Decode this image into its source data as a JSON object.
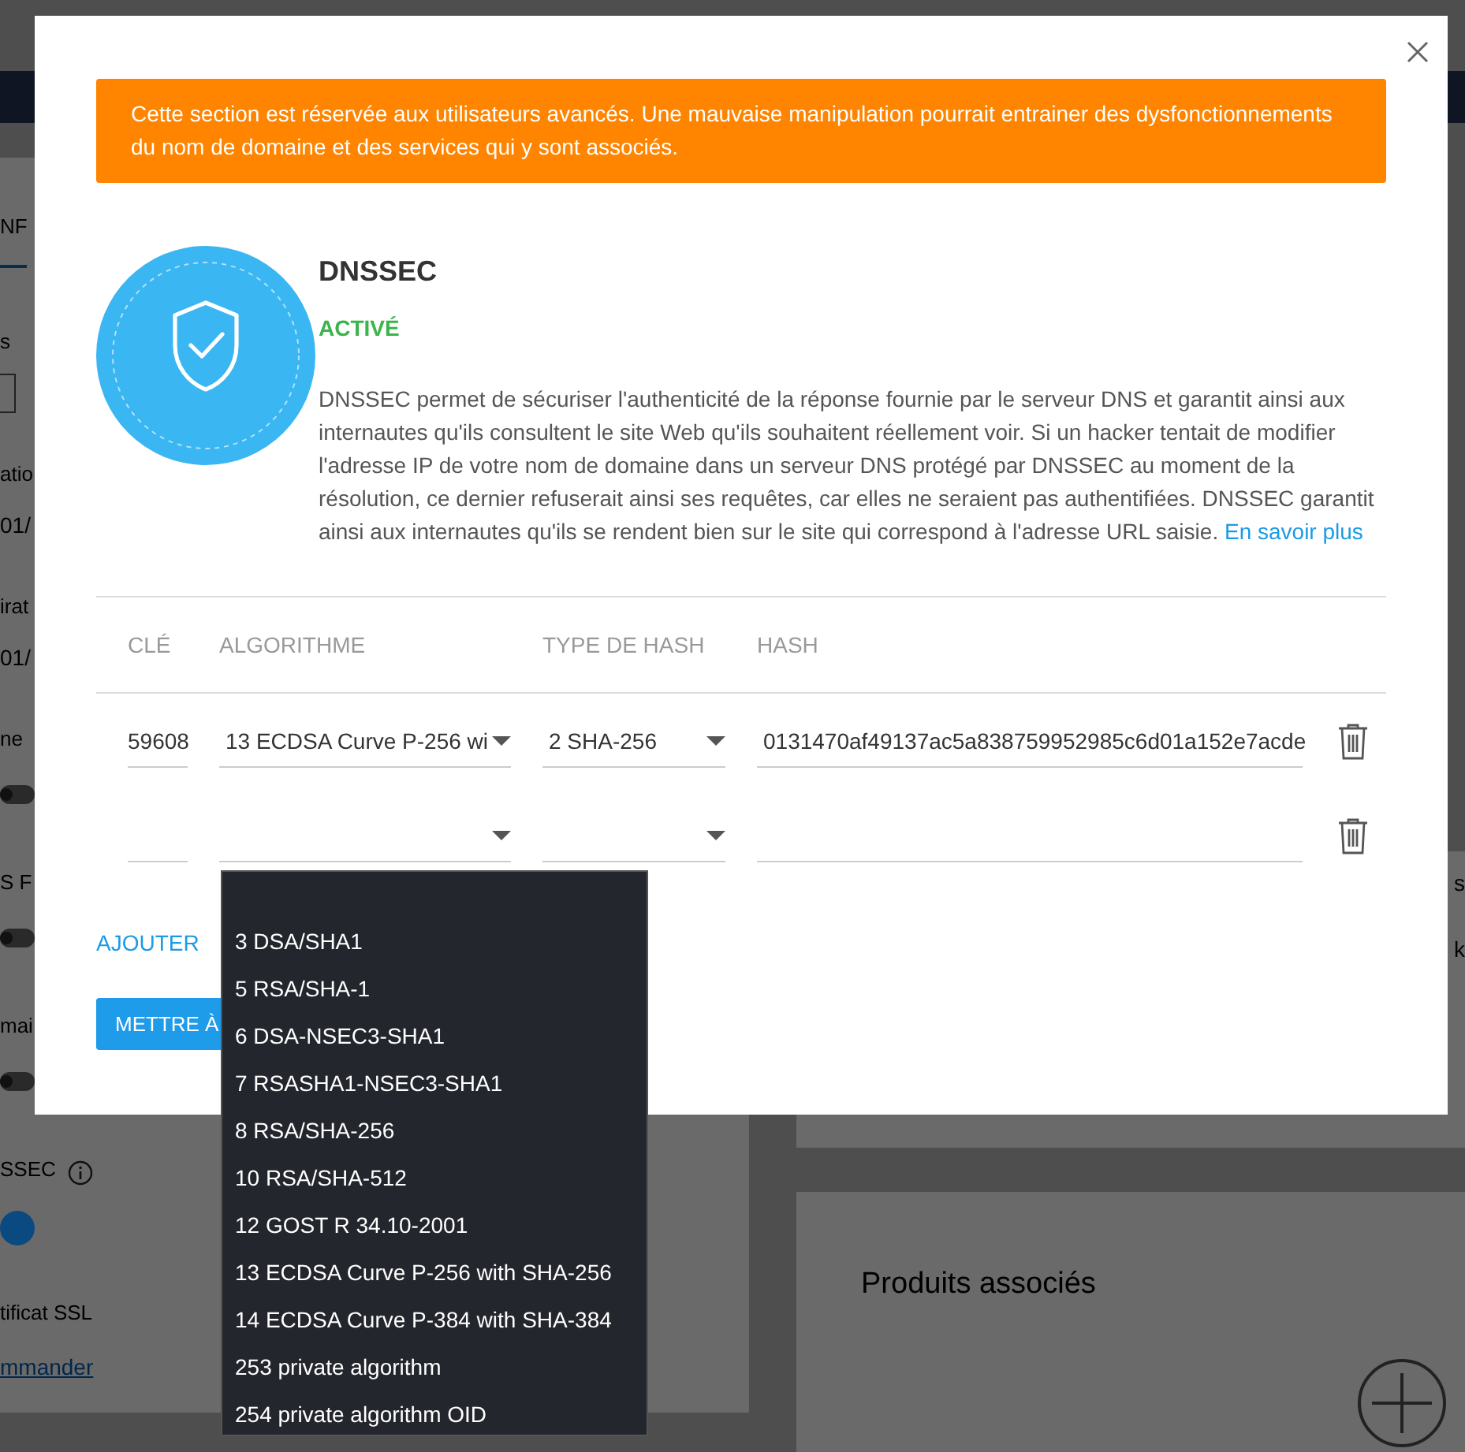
{
  "background_page": {
    "left_panel": {
      "tab": "NF",
      "groups": [
        {
          "label": "s",
          "kind": "field"
        },
        {
          "label": "atio",
          "kind": "value",
          "value": "01/"
        },
        {
          "label": "irat",
          "kind": "value",
          "value": "01/"
        },
        {
          "label": "ne",
          "kind": "toggle",
          "on": false
        },
        {
          "label": "S F",
          "kind": "toggle",
          "on": false
        },
        {
          "label": "mai",
          "kind": "toggle",
          "on": false
        },
        {
          "label": "SSEC",
          "kind": "toggle",
          "on": true,
          "info": true
        },
        {
          "label": "tificat SSL",
          "kind": "link",
          "value": "mmander"
        }
      ]
    },
    "right_panel": {
      "edge_texts": [
        "s",
        "k"
      ]
    },
    "products_panel": {
      "title": "Produits associés"
    }
  },
  "modal": {
    "warning": "Cette section est réservée aux utilisateurs avancés. Une mauvaise manipulation pourrait entrainer des dysfonctionnements du nom de domaine et des services qui y sont associés.",
    "title": "DNSSEC",
    "status": "ACTIVÉ",
    "active": true,
    "description": "DNSSEC permet de sécuriser l'authenticité de la réponse fournie par le serveur DNS et garantit ainsi aux internautes qu'ils consultent le site Web qu'ils souhaitent réellement voir. Si un hacker tentait de modifier l'adresse IP de votre nom de domaine dans un serveur DNS protégé par DNSSEC au moment de la résolution, ce dernier refuserait ainsi ses requêtes, car elles ne seraient pas authentifiées. DNSSEC garantit ainsi aux internautes qu'ils se rendent bien sur le site qui correspond à l'adresse URL saisie.",
    "learn_more": "En savoir plus",
    "table": {
      "columns": [
        "CLÉ",
        "ALGORITHME",
        "TYPE DE HASH",
        "HASH"
      ],
      "rows": [
        {
          "key": "59608",
          "algorithm": "13 ECDSA Curve P-256 wi",
          "hash_type": "2 SHA-256",
          "hash": "0131470af49137ac5a838759952985c6d01a152e7acde"
        },
        {}
      ]
    },
    "add_link": "AJOUTER",
    "submit_button": "METTRE À",
    "algorithm_dropdown": {
      "options": [
        "3 DSA/SHA1",
        "5 RSA/SHA-1",
        "6 DSA-NSEC3-SHA1",
        "7 RSASHA1-NSEC3-SHA1",
        "8 RSA/SHA-256",
        "10 RSA/SHA-512",
        "12 GOST R 34.10-2001",
        "13 ECDSA Curve P-256 with SHA-256",
        "14 ECDSA Curve P-384 with SHA-384",
        "253 private algorithm",
        "254 private algorithm OID"
      ]
    }
  }
}
